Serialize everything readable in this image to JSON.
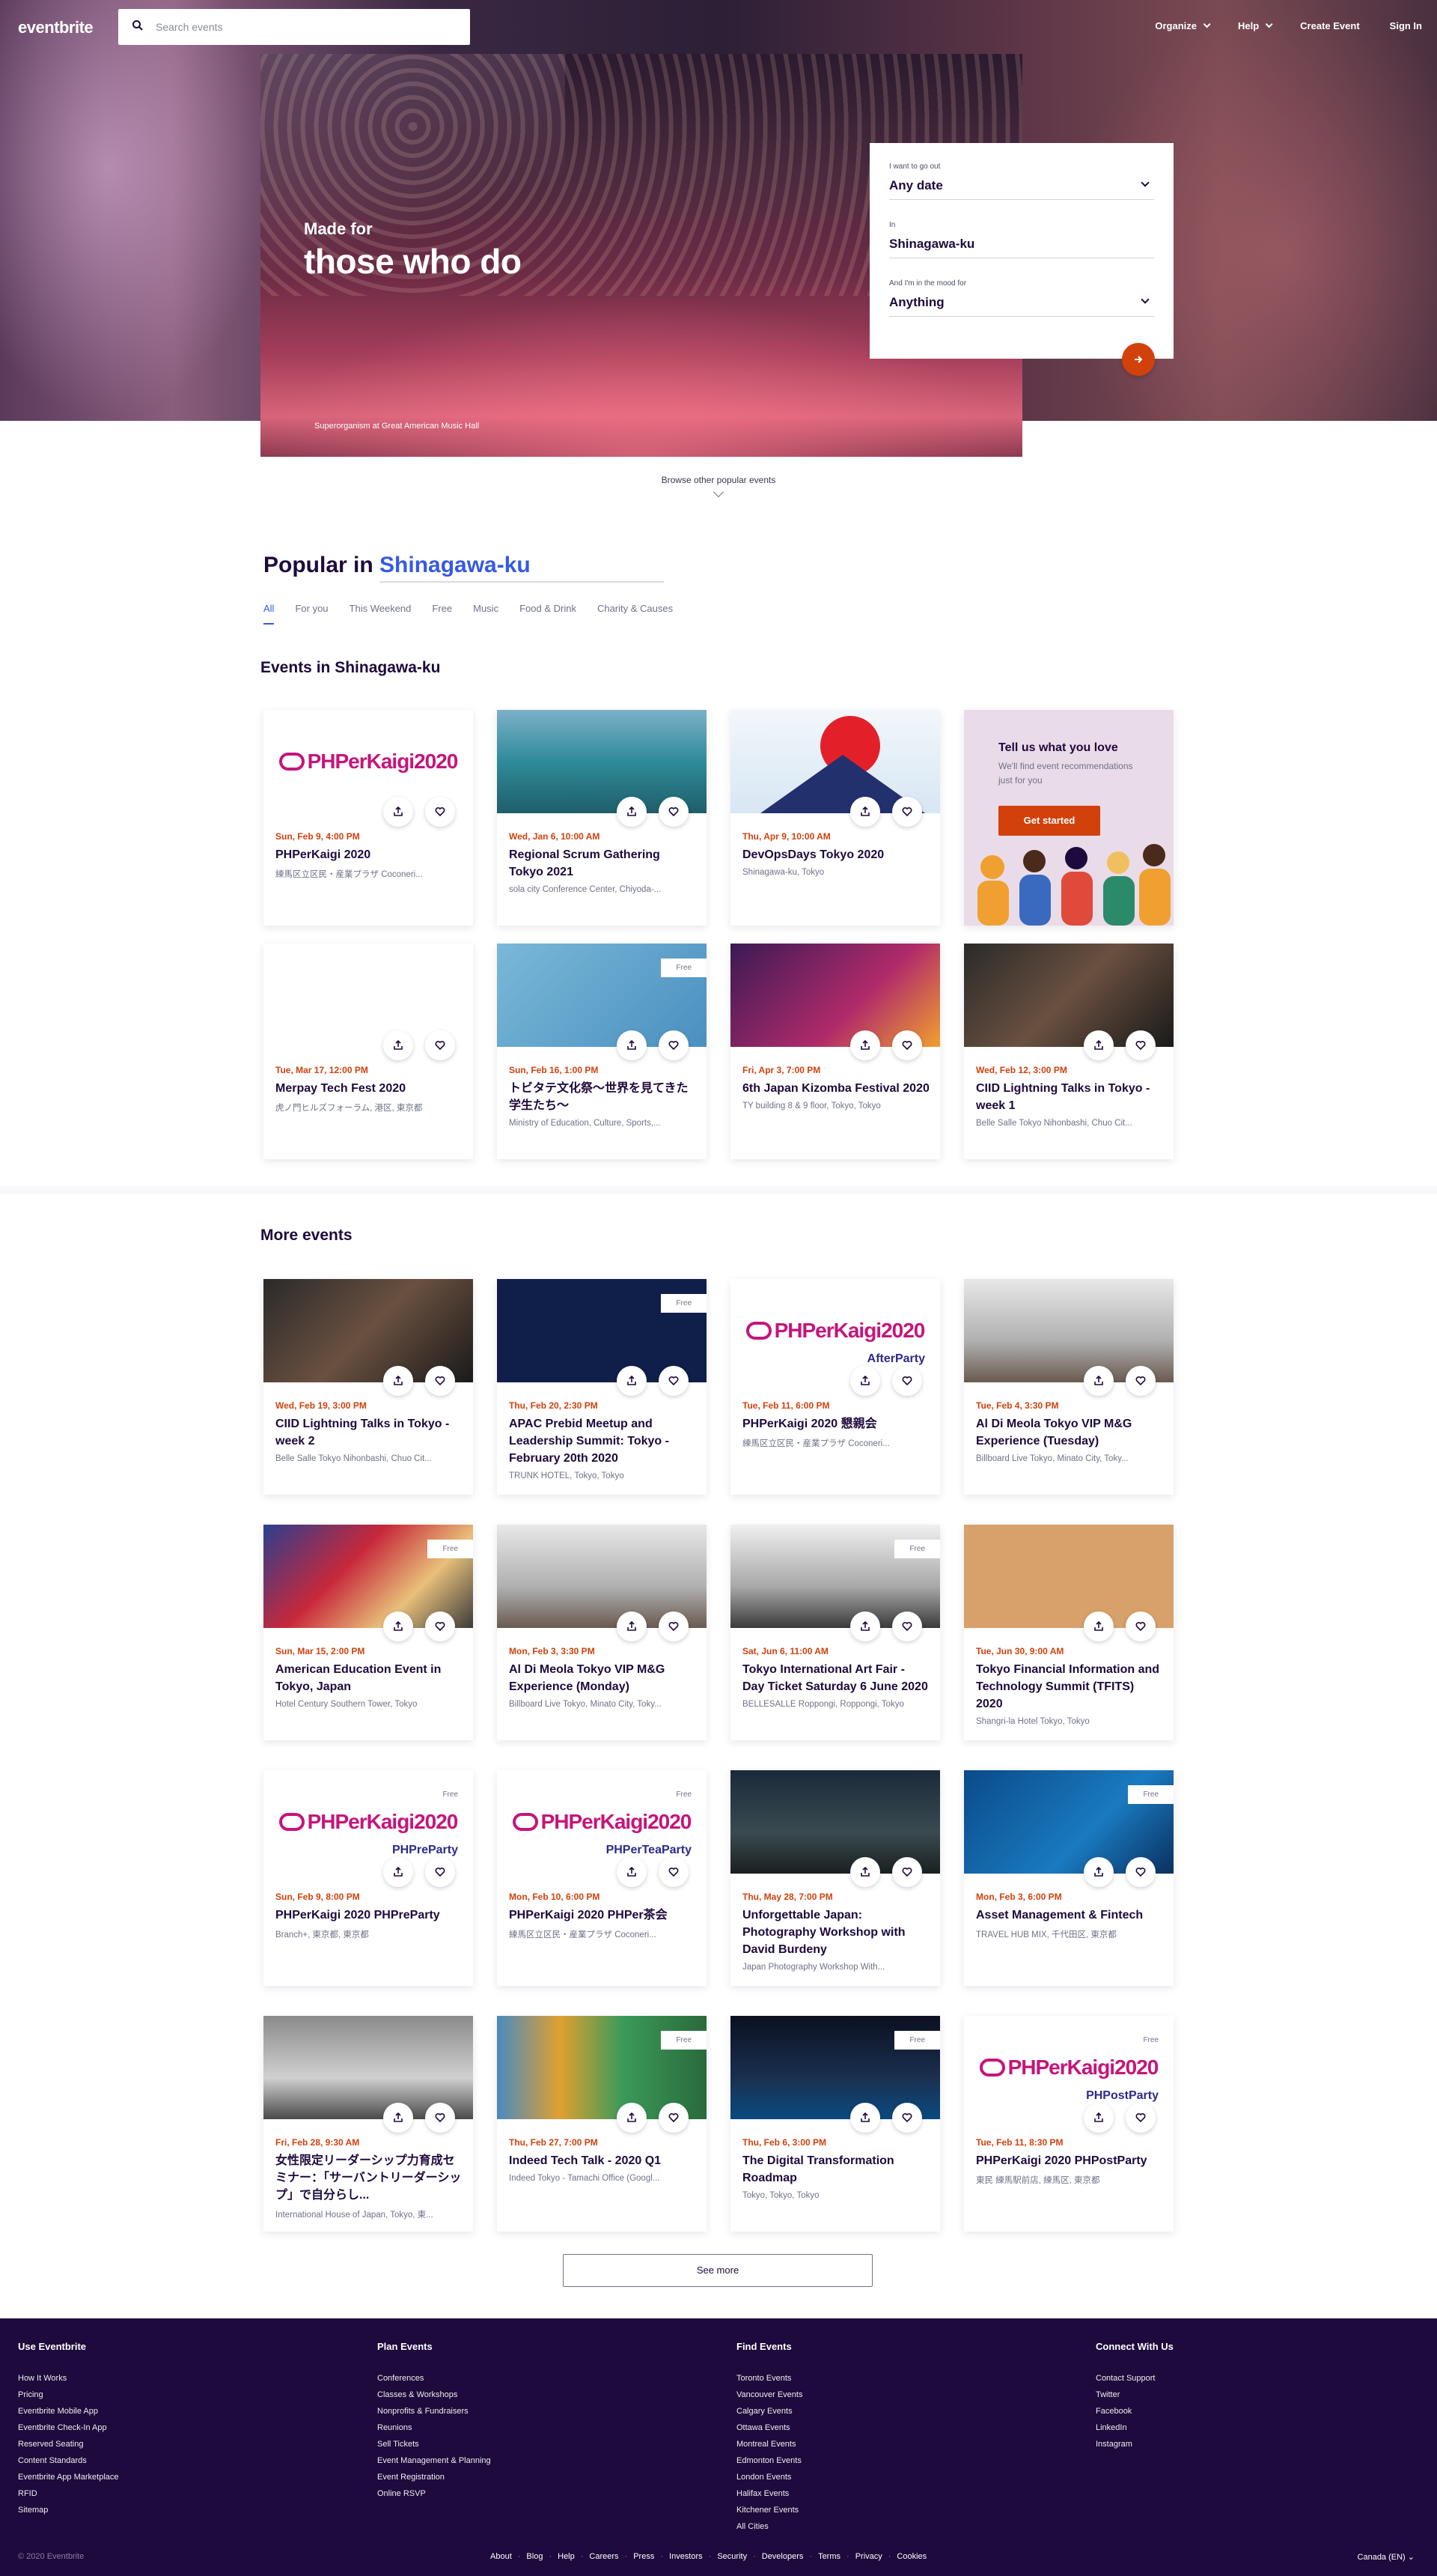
{
  "header": {
    "logo": "eventbrite",
    "search_placeholder": "Search events",
    "nav": [
      "Organize",
      "Help",
      "Create Event",
      "Sign In"
    ]
  },
  "hero": {
    "tagline_small": "Made for",
    "tagline_big": "those who do",
    "caption": "Superorganism at Great American Music Hall",
    "finder": {
      "when_label": "I want to go out",
      "when_value": "Any date",
      "in_label": "In",
      "in_value": "Shinagawa-ku",
      "mood_label": "And I'm in the mood for",
      "mood_value": "Anything"
    },
    "browse": "Browse other popular events"
  },
  "popular": {
    "title": "Popular in",
    "location": "Shinagawa-ku",
    "tabs": [
      "All",
      "For you",
      "This Weekend",
      "Free",
      "Music",
      "Food & Drink",
      "Charity & Causes"
    ]
  },
  "sections": {
    "events_in": "Events in Shinagawa-ku",
    "more": "More events"
  },
  "recommend": {
    "title": "Tell us what you love",
    "text": "We'll find event recommendations just for you",
    "button": "Get started"
  },
  "events_in": [
    {
      "date": "Sun, Feb 9, 4:00 PM",
      "title": "PHPerKaigi 2020",
      "loc": "練馬区立区民・産業プラザ Coconeri...",
      "img": "php",
      "php_sub": ""
    },
    {
      "date": "Wed, Jan 6, 10:00 AM",
      "title": "Regional Scrum Gathering Tokyo 2021",
      "loc": "sola city Conference Center, Chiyoda-...",
      "img": "crowd"
    },
    {
      "date": "Thu, Apr 9, 10:00 AM",
      "title": "DevOpsDays Tokyo 2020",
      "loc": "Shinagawa-ku, Tokyo",
      "img": "devops"
    },
    {
      "date": "Tue, Mar 17, 12:00 PM",
      "title": "Merpay Tech Fest 2020",
      "loc": "虎ノ門ヒルズフォーラム, 港区, 東京都",
      "img": "merpay"
    },
    {
      "date": "Sun, Feb 16, 1:00 PM",
      "title": "トビタテ文化祭〜世界を見てきた学生たち〜",
      "loc": "Ministry of Education, Culture, Sports,...",
      "img": "tobi",
      "free": "Free"
    },
    {
      "date": "Fri, Apr 3, 7:00 PM",
      "title": "6th Japan Kizomba Festival 2020",
      "loc": "TY building 8 & 9 floor, Tokyo, Tokyo",
      "img": "kizomba"
    },
    {
      "date": "Wed, Feb 12, 3:00 PM",
      "title": "CIID Lightning Talks in Tokyo - week 1",
      "loc": "Belle Salle Tokyo Nihonbashi, Chuo Cit...",
      "img": "ciid"
    }
  ],
  "more_events": [
    {
      "date": "Wed, Feb 19, 3:00 PM",
      "title": "CIID Lightning Talks in Tokyo - week 2",
      "loc": "Belle Salle Tokyo Nihonbashi, Chuo Cit...",
      "img": "ciid"
    },
    {
      "date": "Thu, Feb 20, 2:30 PM",
      "title": "APAC Prebid Meetup and Leadership Summit: Tokyo - February 20th 2020",
      "loc": "TRUNK HOTEL, Tokyo, Tokyo",
      "img": "prebid",
      "free": "Free"
    },
    {
      "date": "Tue, Feb 11, 6:00 PM",
      "title": "PHPerKaigi 2020 懇親会",
      "loc": "練馬区立区民・産業プラザ Coconeri...",
      "img": "php",
      "php_sub": "AfterParty"
    },
    {
      "date": "Tue, Feb 4, 3:30 PM",
      "title": "Al Di Meola Tokyo VIP M&G Experience (Tuesday)",
      "loc": "Billboard Live Tokyo, Minato City, Toky...",
      "img": "guitar"
    },
    {
      "date": "Sun, Mar 15, 2:00 PM",
      "title": "American Education Event in Tokyo, Japan",
      "loc": "Hotel Century Southern Tower, Tokyo",
      "img": "aeexpo",
      "free": "Free"
    },
    {
      "date": "Mon, Feb 3, 3:30 PM",
      "title": "Al Di Meola Tokyo VIP M&G Experience (Monday)",
      "loc": "Billboard Live Tokyo, Minato City, Toky...",
      "img": "guitar"
    },
    {
      "date": "Sat, Jun 6, 11:00 AM",
      "title": "Tokyo International Art Fair - Day Ticket Saturday 6 June 2020",
      "loc": "BELLESALLE Roppongi, Roppongi, Tokyo",
      "img": "artfair",
      "free": "Free"
    },
    {
      "date": "Tue, Jun 30, 9:00 AM",
      "title": "Tokyo Financial Information and Technology Summit (TFITS) 2020",
      "loc": "Shangri-la Hotel Tokyo, Tokyo",
      "img": "dots"
    },
    {
      "date": "Sun, Feb 9, 8:00 PM",
      "title": "PHPerKaigi 2020 PHPreParty",
      "loc": "Branch+, 東京都, 東京都",
      "img": "php",
      "php_sub": "PHPreParty",
      "free": "Free"
    },
    {
      "date": "Mon, Feb 10, 6:00 PM",
      "title": "PHPerKaigi 2020 PHPer茶会",
      "loc": "練馬区立区民・産業プラザ Coconeri...",
      "img": "php",
      "php_sub": "PHPerTeaParty",
      "free": "Free"
    },
    {
      "date": "Thu, May 28, 7:00 PM",
      "title": "Unforgettable Japan: Photography Workshop with David Burdeny",
      "loc": "Japan Photography Workshop With...",
      "img": "japan"
    },
    {
      "date": "Mon, Feb 3, 6:00 PM",
      "title": "Asset Management & Fintech",
      "loc": "TRAVEL HUB MIX, 千代田区, 東京都",
      "img": "asset",
      "free": "Free"
    },
    {
      "date": "Fri, Feb 28, 9:30 AM",
      "title": "女性限定リーダーシップ力育成セミナー：「サーバントリーダーシップ」で自分らし...",
      "loc": "International House of Japan, Tokyo, 東...",
      "img": "lady"
    },
    {
      "date": "Thu, Feb 27, 7:00 PM",
      "title": "Indeed Tech Talk - 2020 Q1",
      "loc": "Indeed Tokyo - Tamachi Office (Googl...",
      "img": "indeed",
      "free": "Free"
    },
    {
      "date": "Thu, Feb 6, 3:00 PM",
      "title": "The Digital Transformation Roadmap",
      "loc": "Tokyo, Tokyo, Tokyo",
      "img": "digital",
      "free": "Free"
    },
    {
      "date": "Tue, Feb 11, 8:30 PM",
      "title": "PHPerKaigi 2020 PHPostParty",
      "loc": "東民 練馬駅前店, 練馬区, 東京都",
      "img": "php",
      "php_sub": "PHPostParty",
      "free": "Free"
    }
  ],
  "see_more": "See more",
  "footer": {
    "cols": [
      {
        "title": "Use Eventbrite",
        "links": [
          "How It Works",
          "Pricing",
          "Eventbrite Mobile App",
          "Eventbrite Check-In App",
          "Reserved Seating",
          "Content Standards",
          "Eventbrite App Marketplace",
          "RFID",
          "Sitemap"
        ]
      },
      {
        "title": "Plan Events",
        "links": [
          "Conferences",
          "Classes & Workshops",
          "Nonprofits & Fundraisers",
          "Reunions",
          "Sell Tickets",
          "Event Management & Planning",
          "Event Registration",
          "Online RSVP"
        ]
      },
      {
        "title": "Find Events",
        "links": [
          "Toronto Events",
          "Vancouver Events",
          "Calgary Events",
          "Ottawa Events",
          "Montreal Events",
          "Edmonton Events",
          "London Events",
          "Halifax Events",
          "Kitchener Events",
          "All Cities"
        ]
      },
      {
        "title": "Connect With Us",
        "links": [
          "Contact Support",
          "Twitter",
          "Facebook",
          "LinkedIn",
          "Instagram"
        ]
      }
    ],
    "copyright": "© 2020 Eventbrite",
    "bottom_links": [
      "About",
      "Blog",
      "Help",
      "Careers",
      "Press",
      "Investors",
      "Security",
      "Developers",
      "Terms",
      "Privacy",
      "Cookies"
    ],
    "language": "Canada (EN)"
  },
  "colors": {
    "accent": "#d1410c",
    "link": "#3659e3",
    "footer_bg": "#1e0a3c",
    "text": "#1e0a3c"
  }
}
